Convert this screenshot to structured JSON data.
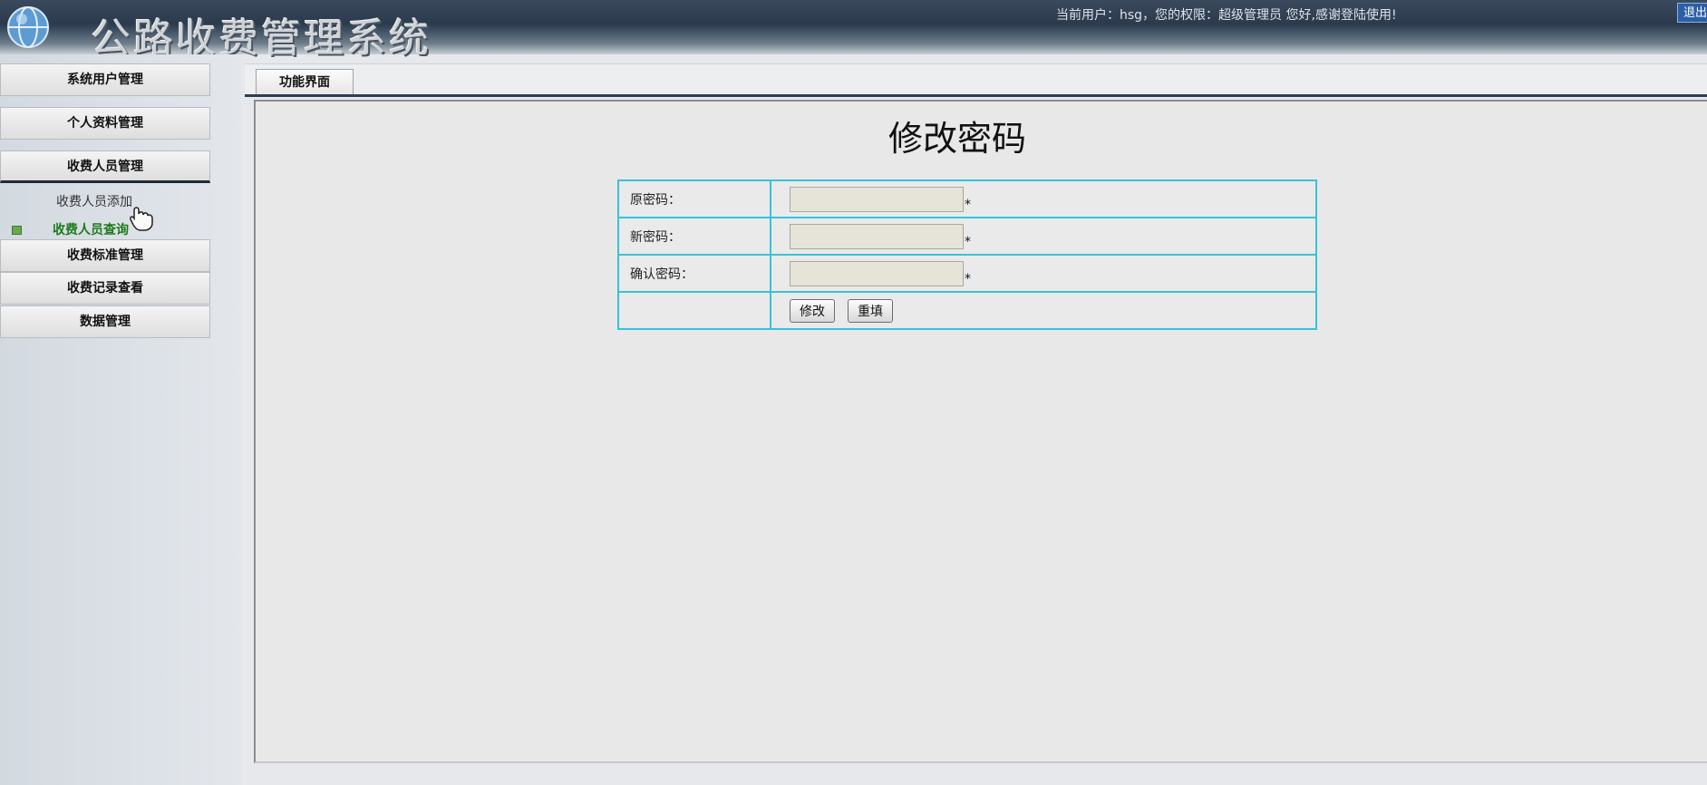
{
  "header": {
    "app_title": "公路收费管理系统",
    "user_info": "当前用户：hsg，您的权限：超级管理员 您好,感谢登陆使用!",
    "logout_label": "退出"
  },
  "sidebar": {
    "items": [
      {
        "label": "系统用户管理"
      },
      {
        "label": "个人资料管理"
      },
      {
        "label": "收费人员管理"
      },
      {
        "label": "收费标准管理"
      },
      {
        "label": "收费记录查看"
      },
      {
        "label": "数据管理"
      }
    ],
    "sub_items": [
      {
        "label": "收费人员添加"
      },
      {
        "label": "收费人员查询"
      }
    ]
  },
  "tabs": [
    {
      "label": "功能界面"
    }
  ],
  "form": {
    "title": "修改密码",
    "fields": [
      {
        "label": "原密码：",
        "value": "",
        "required_mark": "*"
      },
      {
        "label": "新密码：",
        "value": "",
        "required_mark": "*"
      },
      {
        "label": "确认密码：",
        "value": "",
        "required_mark": "*"
      }
    ],
    "submit_label": "修改",
    "reset_label": "重填"
  },
  "colors": {
    "header_dark": "#2b3a4c",
    "table_border": "#38c3d8",
    "active_submenu": "#1c7a1c",
    "input_bg": "#e6e4d8"
  }
}
